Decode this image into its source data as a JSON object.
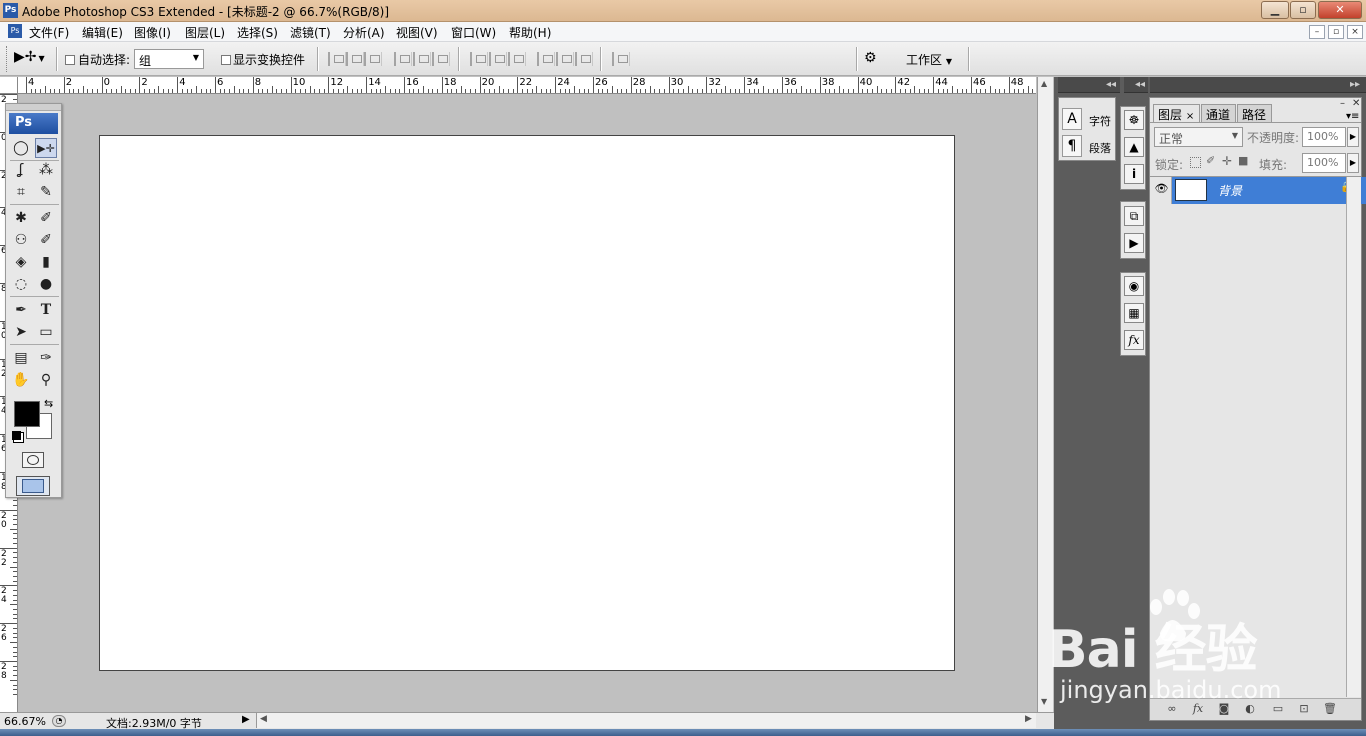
{
  "window": {
    "title": "Adobe Photoshop CS3 Extended - [未标题-2 @ 66.7%(RGB/8)]",
    "app_icon_text": "Ps",
    "controls": [
      "▁",
      "▫",
      "✕"
    ]
  },
  "menubar": {
    "items": [
      "文件(F)",
      "编辑(E)",
      "图像(I)",
      "图层(L)",
      "选择(S)",
      "滤镜(T)",
      "分析(A)",
      "视图(V)",
      "窗口(W)",
      "帮助(H)"
    ],
    "doc_controls": [
      "–",
      "▫",
      "×"
    ]
  },
  "options_bar": {
    "auto_select_label": "自动选择:",
    "auto_select_value": "组",
    "show_transform_label": "显示变换控件",
    "workspace_label": "工作区"
  },
  "ruler": {
    "top_numbers": [
      "4",
      "2",
      "0",
      "2",
      "4",
      "6",
      "8",
      "10",
      "12",
      "14",
      "16",
      "18",
      "20",
      "22",
      "24",
      "26",
      "28",
      "30",
      "32",
      "34",
      "36",
      "38",
      "40",
      "42",
      "44",
      "46",
      "48"
    ],
    "left_numbers": [
      "2",
      "0",
      "2",
      "4",
      "6",
      "8",
      "10",
      "12",
      "14",
      "16",
      "18",
      "20",
      "22",
      "24",
      "26",
      "28"
    ]
  },
  "toolbox": {
    "logo": "Ps",
    "tools": [
      [
        "◯",
        "▶✛"
      ],
      [
        "ʆ",
        "⁂"
      ],
      [
        "⌗",
        "✎"
      ],
      [
        "✱",
        "✐"
      ],
      [
        "⚇",
        "✐"
      ],
      [
        "◈",
        "▮"
      ],
      [
        "◌",
        "●"
      ],
      [
        "✒",
        "T"
      ],
      [
        "➤",
        "▭"
      ],
      [
        "▤",
        "✑"
      ],
      [
        "✋",
        "⚲"
      ]
    ],
    "foreground_color": "#000000",
    "background_color": "#ffffff"
  },
  "status_bar": {
    "zoom": "66.67%",
    "doc_info": "文档:2.93M/0 字节"
  },
  "char_panel": {
    "items": [
      {
        "icon": "A",
        "label": "字符"
      },
      {
        "icon": "¶",
        "label": "段落"
      }
    ]
  },
  "icon_strip": {
    "group1": [
      "☸",
      "▲",
      "i"
    ],
    "group2": [
      "⧉",
      "▶"
    ],
    "group3": [
      "◉",
      "▦",
      "fx"
    ]
  },
  "layers_panel": {
    "tabs": [
      "图层",
      "通道",
      "路径"
    ],
    "close_symbol": "×",
    "blend_mode": "正常",
    "opacity_label": "不透明度:",
    "opacity_value": "100%",
    "lock_label": "锁定:",
    "fill_label": "填充:",
    "fill_value": "100%",
    "layers": [
      {
        "name": "背景",
        "visible": true,
        "locked": true
      }
    ],
    "bottom_icons": [
      "∞",
      "fx",
      "◙",
      "◐",
      "▭",
      "⊡",
      "🗑"
    ]
  },
  "watermark": {
    "main": "Bai  经验",
    "sub": "jingyan.baidu.com"
  }
}
